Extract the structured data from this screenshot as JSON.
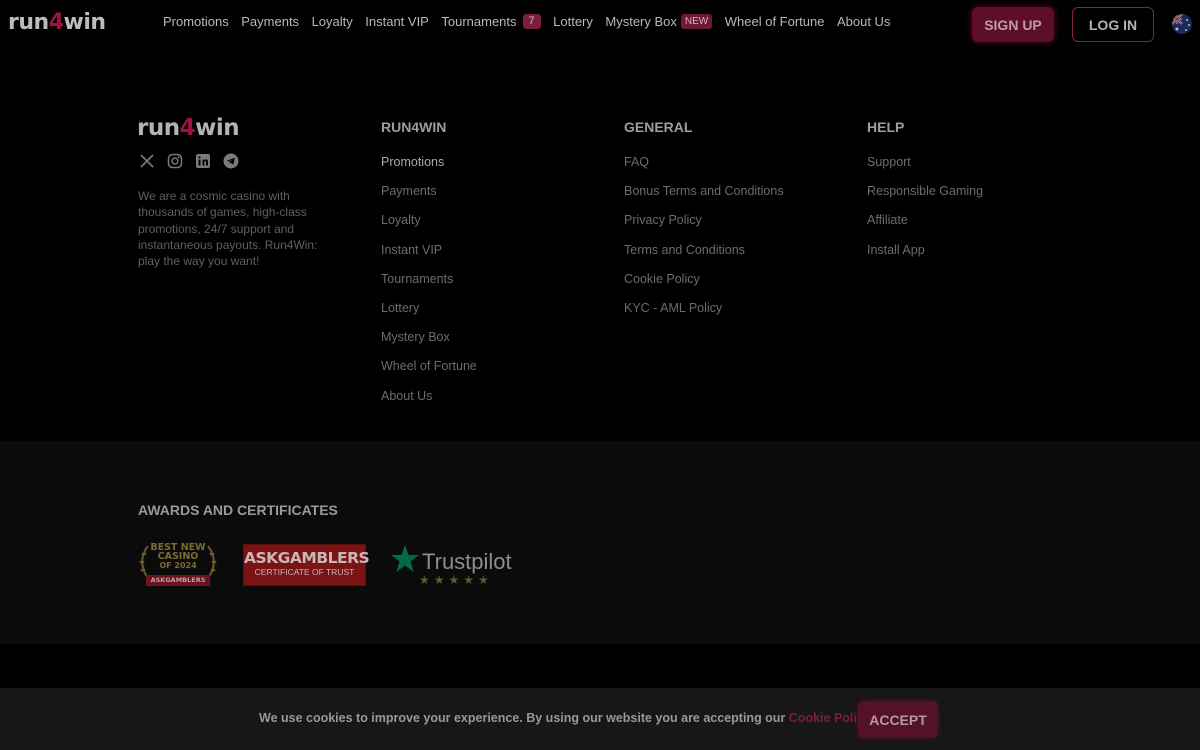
{
  "brand": {
    "prefix": "run",
    "digit": "4",
    "suffix": "win",
    "accent": "#a0123f"
  },
  "nav": {
    "items": [
      {
        "label": "Promotions"
      },
      {
        "label": "Payments"
      },
      {
        "label": "Loyalty"
      },
      {
        "label": "Instant VIP"
      },
      {
        "label": "Tournaments",
        "badge": "7"
      },
      {
        "label": "Lottery"
      },
      {
        "label": "Mystery Box",
        "badge": "NEW"
      },
      {
        "label": "Wheel of Fortune"
      },
      {
        "label": "About Us"
      }
    ],
    "signup_label": "SIGN UP",
    "login_label": "LOG IN",
    "language_icon": "australia-flag-icon"
  },
  "footer": {
    "socials": [
      "x-icon",
      "instagram-icon",
      "linkedin-icon",
      "telegram-icon"
    ],
    "about": "We are a cosmic casino with thousands of games, high-class promotions, 24/7 support and instantaneous payouts. Run4Win: play the way you want!",
    "columns": [
      {
        "title": "RUN4WIN",
        "links": [
          "Promotions",
          "Payments",
          "Loyalty",
          "Instant VIP",
          "Tournaments",
          "Lottery",
          "Mystery Box",
          "Wheel of Fortune",
          "About Us"
        ]
      },
      {
        "title": "GENERAL",
        "links": [
          "FAQ",
          "Bonus Terms and Conditions",
          "Privacy Policy",
          "Terms and Conditions",
          "Cookie Policy",
          "KYC - AML Policy"
        ]
      },
      {
        "title": "HELP",
        "links": [
          "Support",
          "Responsible Gaming",
          "Affiliate",
          "Install App"
        ]
      }
    ]
  },
  "awards": {
    "title": "AWARDS AND CERTIFICATES",
    "best_new": {
      "line1": "BEST NEW",
      "line2": "CASINO",
      "line3": "OF 2024",
      "ribbon": "ASKGAMBLERS"
    },
    "askgamblers": {
      "name": "ASKGAMBLERS",
      "subtitle": "CERTIFICATE OF TRUST"
    },
    "trustpilot": {
      "name": "Trustpilot",
      "stars": "★★★★★"
    }
  },
  "cookie": {
    "text": "We use cookies to improve your experience. By using our website you are accepting our ",
    "link": "Cookie Policy.",
    "accept_label": "ACCEPT"
  }
}
